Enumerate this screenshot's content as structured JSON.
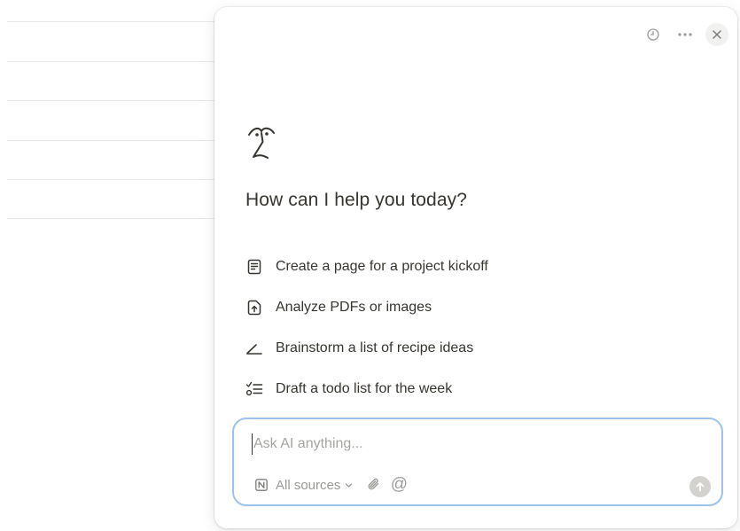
{
  "panel": {
    "headline": "How can I help you today?",
    "header_icons": [
      "history-icon",
      "more-icon",
      "close-icon"
    ],
    "ai_icon": "ai-face-icon"
  },
  "suggestions": [
    {
      "label": "Create a page for a project kickoff",
      "icon": "page-icon"
    },
    {
      "label": "Analyze PDFs or images",
      "icon": "file-upload-icon"
    },
    {
      "label": "Brainstorm a list of recipe ideas",
      "icon": "pencil-icon"
    },
    {
      "label": "Draft a todo list for the week",
      "icon": "checklist-icon"
    }
  ],
  "composer": {
    "placeholder": "Ask AI anything...",
    "value": "",
    "sources_label": "All sources",
    "at_symbol": "@",
    "tool_icons": [
      "notion-icon",
      "chevron-down-icon",
      "paperclip-icon",
      "mention-icon",
      "send-arrow-icon"
    ]
  },
  "colors": {
    "text": "#37352f",
    "muted": "#9b9a97",
    "composer_border": "#9cc3ea",
    "send_button": "#d3d2ce"
  }
}
